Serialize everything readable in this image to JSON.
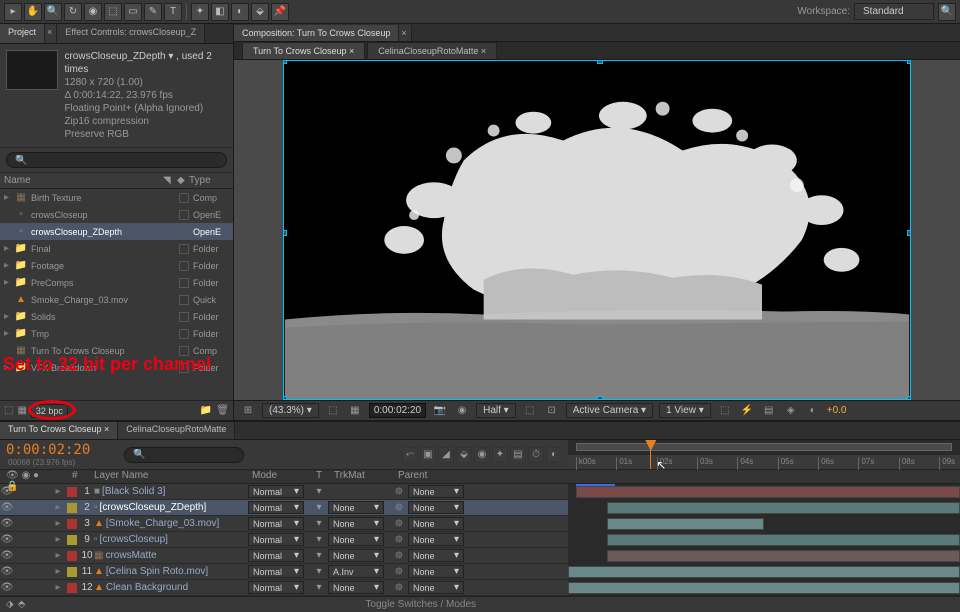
{
  "workspace": {
    "label": "Workspace:",
    "value": "Standard"
  },
  "panels": {
    "project": "Project",
    "effectControls": "Effect Controls: crowsCloseup_Z"
  },
  "project": {
    "title": "crowsCloseup_ZDepth ▾ , used 2 times",
    "dims": "1280 x 720 (1.00)",
    "dur": "Δ 0:00:14:22, 23.976 fps",
    "format": "Floating Point+ (Alpha Ignored)",
    "compression": "Zip16 compression",
    "preserve": "Preserve RGB",
    "searchPlaceholder": "",
    "cols": {
      "name": "Name",
      "type": "Type"
    },
    "items": [
      {
        "name": "Birth Texture",
        "type": "Comp",
        "icon": "comp",
        "arrow": "▸"
      },
      {
        "name": "crowsCloseup",
        "type": "OpenE",
        "icon": "exr",
        "arrow": ""
      },
      {
        "name": "crowsCloseup_ZDepth",
        "type": "OpenE",
        "icon": "exr",
        "arrow": "",
        "selected": true
      },
      {
        "name": "Final",
        "type": "Folder",
        "icon": "folder",
        "arrow": "▸"
      },
      {
        "name": "Footage",
        "type": "Folder",
        "icon": "folder",
        "arrow": "▸"
      },
      {
        "name": "PreComps",
        "type": "Folder",
        "icon": "folder",
        "arrow": "▸"
      },
      {
        "name": "Smoke_Charge_03.mov",
        "type": "Quick",
        "icon": "vlc",
        "arrow": ""
      },
      {
        "name": "Solids",
        "type": "Folder",
        "icon": "folder",
        "arrow": "▸"
      },
      {
        "name": "Tmp",
        "type": "Folder",
        "icon": "folder",
        "arrow": "▸"
      },
      {
        "name": "Turn To Crows Closeup",
        "type": "Comp",
        "icon": "comp",
        "arrow": ""
      },
      {
        "name": "VFX Breakdown",
        "type": "Folder",
        "icon": "folder",
        "arrow": "▸"
      }
    ],
    "bpc": "32 bpc"
  },
  "annotation": "Set to 32 bit per channel",
  "comp": {
    "panelLabel": "Composition: Turn To Crows Closeup",
    "tabs": [
      "Turn To Crows Closeup",
      "CelinaCloseupRotoMatte"
    ],
    "activeTab": 0,
    "footer": {
      "mag": "(43.3%)",
      "timecode": "0:00:02:20",
      "res": "Half",
      "camera": "Active Camera",
      "view": "1 View",
      "exposure": "+0.0"
    }
  },
  "timeline": {
    "tabs": [
      "Turn To Crows Closeup",
      "CelinaCloseupRotoMatte"
    ],
    "timecode": "0:00:02:20",
    "subtime": "00068 (23.976 fps)",
    "ruler": [
      "k00s",
      "01s",
      "02s",
      "03s",
      "04s",
      "05s",
      "06s",
      "07s",
      "08s",
      "09s"
    ],
    "cols": {
      "num": "#",
      "layerName": "Layer Name",
      "mode": "Mode",
      "t": "T",
      "trkMat": "TrkMat",
      "parent": "Parent"
    },
    "layers": [
      {
        "num": 1,
        "name": "[Black Solid 3]",
        "color": "#a33",
        "icon": "solid",
        "mode": "Normal",
        "trk": "",
        "parent": "None",
        "barStart": 2,
        "barEnd": 100,
        "barColor": "#7a4a4a"
      },
      {
        "num": 2,
        "name": "[crowsCloseup_ZDepth]",
        "color": "#a93",
        "icon": "exr",
        "mode": "Normal",
        "trk": "None",
        "parent": "None",
        "barStart": 10,
        "barEnd": 100,
        "barColor": "#5a7a7a",
        "selected": true
      },
      {
        "num": 3,
        "name": "[Smoke_Charge_03.mov]",
        "color": "#a33",
        "icon": "vlc",
        "mode": "Normal",
        "trk": "None",
        "parent": "None",
        "barStart": 10,
        "barEnd": 50,
        "barColor": "#6a8a8a"
      },
      {
        "num": 9,
        "name": "[crowsCloseup]",
        "color": "#a93",
        "icon": "exr",
        "mode": "Normal",
        "trk": "None",
        "parent": "None",
        "barStart": 10,
        "barEnd": 100,
        "barColor": "#5a7a7a"
      },
      {
        "num": 10,
        "name": "crowsMatte",
        "color": "#a33",
        "icon": "comp",
        "mode": "Normal",
        "trk": "None",
        "parent": "None",
        "barStart": 10,
        "barEnd": 100,
        "barColor": "#6a5a5a"
      },
      {
        "num": 11,
        "name": "[Celina Spin Roto.mov]",
        "color": "#a93",
        "icon": "vlc",
        "mode": "Normal",
        "trk": "A.Inv",
        "parent": "None",
        "barStart": 0,
        "barEnd": 100,
        "barColor": "#6a8a8a"
      },
      {
        "num": 12,
        "name": "Clean Background",
        "color": "#a33",
        "icon": "vlc",
        "mode": "Normal",
        "trk": "None",
        "parent": "None",
        "barStart": 0,
        "barEnd": 100,
        "barColor": "#6a8a8a"
      }
    ],
    "toggleLabel": "Toggle Switches / Modes"
  }
}
